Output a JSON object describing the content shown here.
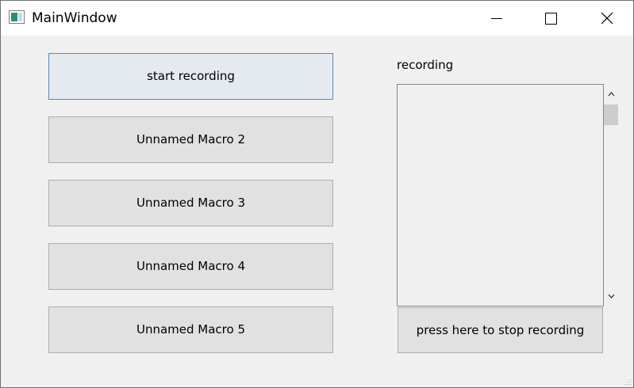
{
  "window": {
    "title": "MainWindow"
  },
  "macros": [
    {
      "label": "start recording",
      "state": "focused"
    },
    {
      "label": "Unnamed Macro 2"
    },
    {
      "label": "Unnamed Macro 3"
    },
    {
      "label": "Unnamed Macro 4"
    },
    {
      "label": "Unnamed Macro 5"
    }
  ],
  "recording_panel": {
    "label": "recording",
    "items": [],
    "stop_button_label": "press here to stop recording"
  },
  "icons": {
    "app": "app-window-icon",
    "minimize": "minimize-icon",
    "maximize": "maximize-icon",
    "close": "close-icon",
    "scroll_up": "chevron-up-icon",
    "scroll_down": "chevron-down-icon",
    "resize_grip": "resize-grip-icon"
  },
  "colors": {
    "window_bg": "#f0f0f0",
    "button_bg": "#e1e1e1",
    "focused_button_bg": "#e5e9f0",
    "focused_button_border": "#5b8ab8"
  }
}
